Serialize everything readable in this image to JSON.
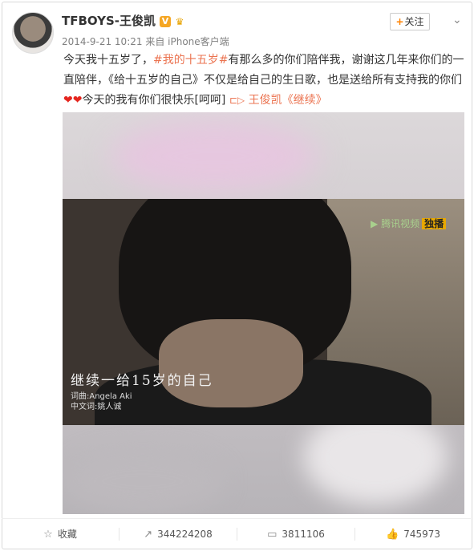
{
  "post": {
    "author": "TFBOYS-王俊凯",
    "verified_icon": "verified-v-icon",
    "vip_icon": "crown-icon",
    "timestamp": "2014-9-21 10:21",
    "source": "来自 iPhone客户端",
    "follow_label": "关注",
    "text": {
      "part1": "今天我十五岁了，",
      "hashtag": "#我的十五岁#",
      "part2": "有那么多的你们陪伴我，谢谢这几年来你们的一直陪伴，《给十五岁的自己》不仅是给自己的生日歌，也是送给所有支持我的你们",
      "hearts": "❤❤",
      "part3": "今天的我有你们很快乐[呵呵]",
      "video_link": "王俊凯《继续》"
    }
  },
  "video": {
    "logo_text": "腾讯视频",
    "live_badge": "独播",
    "subtitle": "继续一给15岁的自己",
    "credit_line1": "词曲:Angela Aki",
    "credit_line2": "中文词:姚人诚"
  },
  "actions": {
    "collect": "收藏",
    "repost": "344224208",
    "comment": "3811106",
    "like": "745973"
  },
  "colors": {
    "accent": "#eb7350",
    "follow_plus": "#ff8200"
  }
}
